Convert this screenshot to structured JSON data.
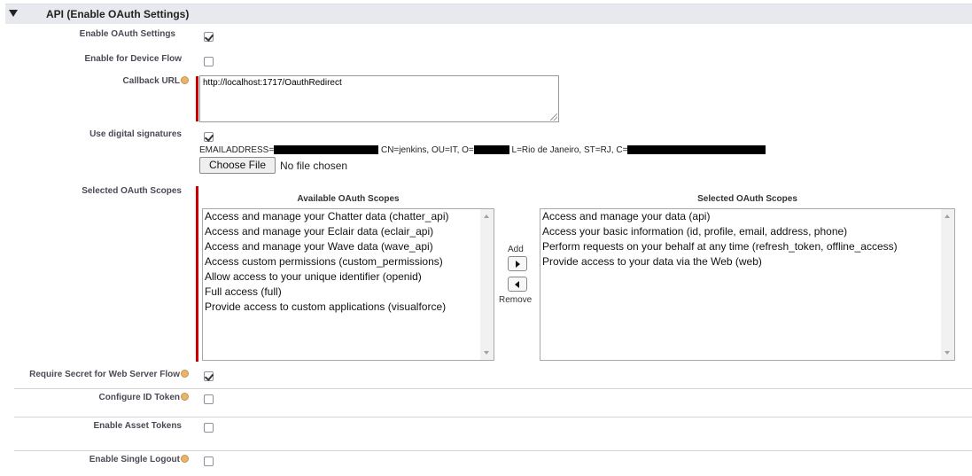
{
  "section": {
    "title": "API (Enable OAuth Settings)"
  },
  "fields": {
    "enable_oauth": {
      "label": "Enable OAuth Settings",
      "checked": true
    },
    "device_flow": {
      "label": "Enable for Device Flow",
      "checked": false
    },
    "callback_url": {
      "label": "Callback URL",
      "value": "http://localhost:1717/OauthRedirect"
    },
    "digital_signatures": {
      "label": "Use digital signatures",
      "checked": true,
      "cert_prefix": "EMAILADDRESS=",
      "cert_part2": "CN=jenkins, OU=IT, O=",
      "cert_part3": "L=Rio de Janeiro, ST=RJ, C=",
      "file_button": "Choose File",
      "file_status": "No file chosen"
    },
    "scopes": {
      "label": "Selected OAuth Scopes",
      "available_header": "Available OAuth Scopes",
      "selected_header": "Selected OAuth Scopes",
      "add_label": "Add",
      "remove_label": "Remove",
      "available": [
        "Access and manage your Chatter data (chatter_api)",
        "Access and manage your Eclair data (eclair_api)",
        "Access and manage your Wave data (wave_api)",
        "Access custom permissions (custom_permissions)",
        "Allow access to your unique identifier (openid)",
        "Full access (full)",
        "Provide access to custom applications (visualforce)"
      ],
      "selected": [
        "Access and manage your data (api)",
        "Access your basic information (id, profile, email, address, phone)",
        "Perform requests on your behalf at any time (refresh_token, offline_access)",
        "Provide access to your data via the Web (web)"
      ]
    },
    "require_secret": {
      "label": "Require Secret for Web Server Flow",
      "checked": true
    },
    "configure_id_token": {
      "label": "Configure ID Token",
      "checked": false
    },
    "asset_tokens": {
      "label": "Enable Asset Tokens",
      "checked": false
    },
    "single_logout": {
      "label": "Enable Single Logout",
      "checked": false
    }
  },
  "colors": {
    "required_bar": "#cc0000",
    "header_bg": "#e7e9ee",
    "help_icon": "#e8b56a"
  }
}
